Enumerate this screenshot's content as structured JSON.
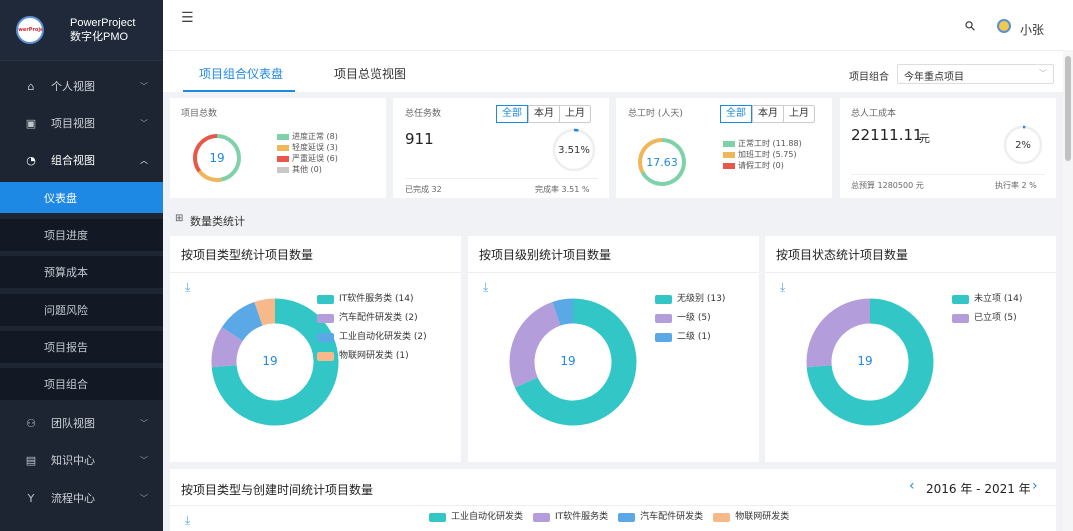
{
  "brand": {
    "name": "PowerProject",
    "subtitle": "数字化PMO"
  },
  "sidebar": {
    "items": [
      {
        "label": "个人视图",
        "icon": "home-icon",
        "glyph": "⌂"
      },
      {
        "label": "项目视图",
        "icon": "folder-icon",
        "glyph": "▣"
      },
      {
        "label": "组合视图",
        "icon": "dashboard-icon",
        "glyph": "◔",
        "expanded": true
      },
      {
        "label": "团队视图",
        "icon": "team-icon",
        "glyph": "⚇"
      },
      {
        "label": "知识中心",
        "icon": "book-icon",
        "glyph": "▤"
      },
      {
        "label": "流程中心",
        "icon": "flow-icon",
        "glyph": "Y"
      }
    ],
    "sub": [
      "仪表盘",
      "项目进度",
      "预算成本",
      "问题风险",
      "项目报告",
      "项目组合"
    ],
    "active_sub": "仪表盘"
  },
  "topbar": {
    "menu_glyph": "☰",
    "search_glyph": "⚲",
    "user": "小张"
  },
  "tabs": [
    {
      "label": "项目组合仪表盘"
    },
    {
      "label": "项目总览视图"
    }
  ],
  "portfolio": {
    "label": "项目组合",
    "value": "今年重点项目"
  },
  "cards": {
    "total": {
      "title": "项目总数",
      "count": "19",
      "legend": [
        "进度正常 (8)",
        "轻度延误 (3)",
        "严重延误 (6)",
        "其他 (0)"
      ],
      "colors": [
        "#7fd1a9",
        "#f0b65a",
        "#e8584a",
        "#c8c8c8"
      ],
      "values": [
        8,
        3,
        6,
        0
      ]
    },
    "tasks": {
      "title": "总任务数",
      "count": "911",
      "seg": [
        "全部",
        "本月",
        "上月"
      ],
      "pct": "3.51%",
      "pct_value": 0.0351,
      "done": "已完成 32",
      "rate": "完成率 3.51 %"
    },
    "hours": {
      "title": "总工时 (人天)",
      "count": "17.63",
      "seg": [
        "全部",
        "本月",
        "上月"
      ],
      "legend": [
        "正常工时 (11.88)",
        "加班工时 (5.75)",
        "请假工时 (0)"
      ],
      "colors": [
        "#7fd1a9",
        "#f0b65a",
        "#e8584a"
      ],
      "values": [
        11.88,
        5.75,
        0
      ]
    },
    "cost": {
      "title": "总人工成本",
      "amount": "22111.11",
      "unit": "元",
      "pct": "2%",
      "pct_value": 0.02,
      "budget": "总预算 1280500 元",
      "rate": "执行率 2 %"
    }
  },
  "section_title": "数量类统计",
  "section_glyph": "⊞",
  "download_glyph": "⤓",
  "chart_data": [
    {
      "type": "pie",
      "title": "按项目类型统计项目数量",
      "total": "19",
      "categories": [
        "IT软件服务类 (14)",
        "汽车配件研发类 (2)",
        "工业自动化研发类 (2)",
        "物联网研发类 (1)"
      ],
      "values": [
        14,
        2,
        2,
        1
      ],
      "colors": [
        "#33c6c7",
        "#b39ddb",
        "#5aa9e6",
        "#f8b98a"
      ]
    },
    {
      "type": "pie",
      "title": "按项目级别统计项目数量",
      "total": "19",
      "categories": [
        "无级别 (13)",
        "一级 (5)",
        "二级 (1)"
      ],
      "values": [
        13,
        5,
        1
      ],
      "colors": [
        "#33c6c7",
        "#b39ddb",
        "#5aa9e6"
      ]
    },
    {
      "type": "pie",
      "title": "按项目状态统计项目数量",
      "total": "19",
      "categories": [
        "未立项 (14)",
        "已立项 (5)"
      ],
      "values": [
        14,
        5
      ],
      "colors": [
        "#33c6c7",
        "#b39ddb"
      ]
    }
  ],
  "bottom": {
    "title": "按项目类型与创建时间统计项目数量",
    "range": "2016 年 - 2021 年",
    "prev": "‹",
    "next": "›",
    "legend": [
      "工业自动化研发类",
      "IT软件服务类",
      "汽车配件研发类",
      "物联网研发类"
    ],
    "colors": [
      "#33c6c7",
      "#b39ddb",
      "#5aa9e6",
      "#f8b98a"
    ]
  }
}
